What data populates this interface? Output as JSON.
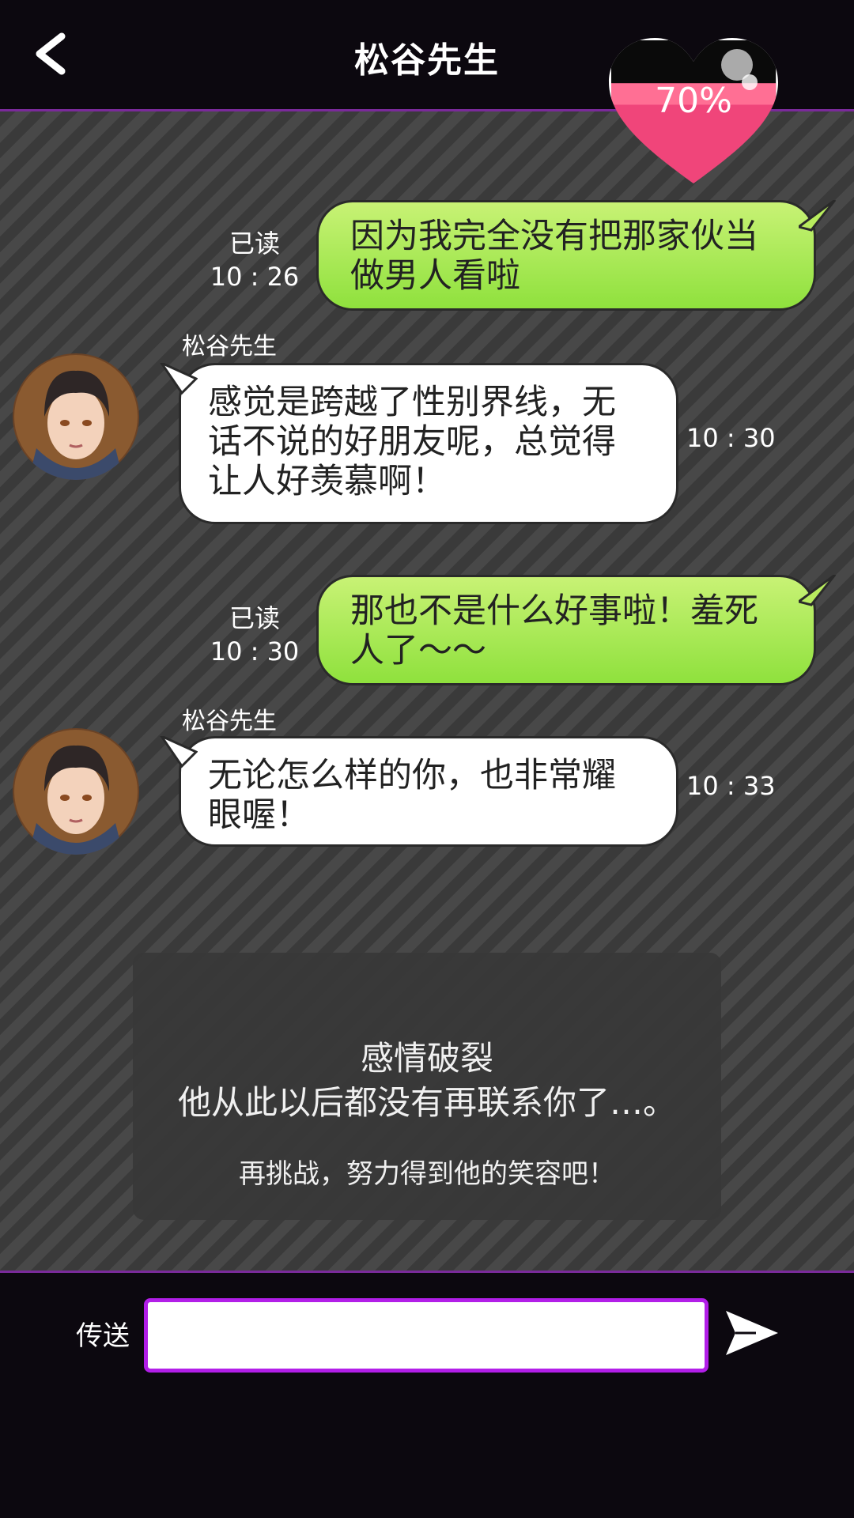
{
  "header": {
    "title": "松谷先生",
    "back_icon": "chevron-left-icon"
  },
  "affection": {
    "percent_label": "70%",
    "level": 0.7,
    "icon": "heart-icon"
  },
  "messages": [
    {
      "from": "me",
      "read_label": "已读",
      "time": "10 : 26",
      "lines": [
        "因为我完全没有把那家伙当",
        "做男人看啦"
      ]
    },
    {
      "from": "him",
      "sender": "松谷先生",
      "time": "10 : 30",
      "lines": [
        "感觉是跨越了性别界线，无",
        "话不说的好朋友呢，总觉得",
        "让人好羡慕啊！"
      ]
    },
    {
      "from": "me",
      "read_label": "已读",
      "time": "10 : 30",
      "lines": [
        "那也不是什么好事啦！羞死",
        "人了～～"
      ]
    },
    {
      "from": "him",
      "sender": "松谷先生",
      "time": "10 : 33",
      "lines": [
        "无论怎么样的你，也非常耀",
        "眼喔！"
      ]
    }
  ],
  "gameover": {
    "title": "感情破裂",
    "message": "他从此以后都没有再联系你了…。",
    "hint": "再挑战，努力得到他的笑容吧！"
  },
  "footer": {
    "send_label": "传送",
    "input_value": "",
    "send_icon": "send-arrow-icon"
  },
  "colors": {
    "accent": "#b21ee8",
    "my_bubble": "#a8e84e",
    "heart": "#f0457a"
  }
}
